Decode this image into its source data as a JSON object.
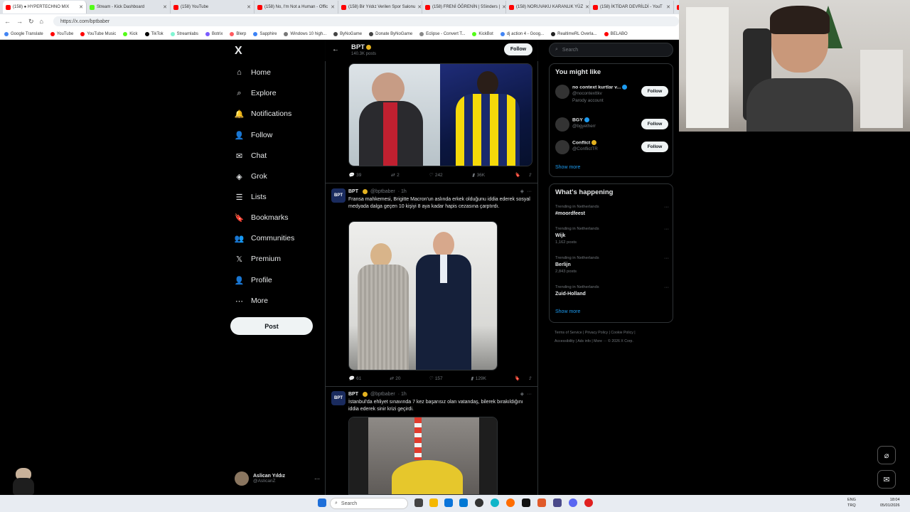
{
  "browser": {
    "tabs": [
      {
        "label": "(158) ● HYPERTECHNO MIX",
        "color": "#ff0000",
        "active": true
      },
      {
        "label": "Stream - Kick Dashboard",
        "color": "#53fc18"
      },
      {
        "label": "(158) YouTube",
        "color": "#ff0000"
      },
      {
        "label": "(158) No, I'm Not a Human - Offic",
        "color": "#ff0000"
      },
      {
        "label": "(158) Bir Yıldız Verilen Spor Salonu",
        "color": "#ff0000"
      },
      {
        "label": "(158) FRENİ ÖĞRENİN | 5Sinders |",
        "color": "#ff0000"
      },
      {
        "label": "(158) NORUVAKU KARANLIK YÜZ",
        "color": "#ff0000"
      },
      {
        "label": "(158) İKTİDAR DEVRİLDİ - YouT",
        "color": "#ff0000"
      },
      {
        "label": "BELABO",
        "color": "#ff0000"
      }
    ],
    "url": "https://x.com/bptbaber",
    "bookmarks": [
      {
        "label": "Google Translate",
        "color": "#4285f4"
      },
      {
        "label": "YouTube",
        "color": "#ff0000"
      },
      {
        "label": "YouTube Music",
        "color": "#ff0000"
      },
      {
        "label": "Kick",
        "color": "#53fc18"
      },
      {
        "label": "TikTok",
        "color": "#000000"
      },
      {
        "label": "Streamlabs",
        "color": "#80f5d2"
      },
      {
        "label": "Botrix",
        "color": "#7b5cff"
      },
      {
        "label": "Blerp",
        "color": "#ff5a5f"
      },
      {
        "label": "Sapphire",
        "color": "#3b82f6"
      },
      {
        "label": "Windows 10 high...",
        "color": "#777777"
      },
      {
        "label": "ByNoGame",
        "color": "#444444"
      },
      {
        "label": "Donate ByNoGame",
        "color": "#444444"
      },
      {
        "label": "Eclipse - Convert T...",
        "color": "#888888"
      },
      {
        "label": "KickBot",
        "color": "#53fc18"
      },
      {
        "label": "dj action 4 - Goog...",
        "color": "#4285f4"
      },
      {
        "label": "RealtimeRL Overla...",
        "color": "#222222"
      },
      {
        "label": "BELABO",
        "color": "#ff0000"
      }
    ]
  },
  "nav": {
    "logo": "X",
    "items": [
      {
        "name": "home",
        "label": "Home",
        "icon": "⌂"
      },
      {
        "name": "explore",
        "label": "Explore",
        "icon": "⌕"
      },
      {
        "name": "notifications",
        "label": "Notifications",
        "icon": "🔔"
      },
      {
        "name": "follow",
        "label": "Follow",
        "icon": "👤"
      },
      {
        "name": "chat",
        "label": "Chat",
        "icon": "✉"
      },
      {
        "name": "grok",
        "label": "Grok",
        "icon": "◈"
      },
      {
        "name": "lists",
        "label": "Lists",
        "icon": "☰"
      },
      {
        "name": "bookmarks",
        "label": "Bookmarks",
        "icon": "🔖"
      },
      {
        "name": "communities",
        "label": "Communities",
        "icon": "👥"
      },
      {
        "name": "premium",
        "label": "Premium",
        "icon": "𝕏"
      },
      {
        "name": "profile",
        "label": "Profile",
        "icon": "👤"
      },
      {
        "name": "more",
        "label": "More",
        "icon": "⋯"
      }
    ],
    "post_label": "Post",
    "account": {
      "name": "Aslican Yıldız",
      "handle": "@AslicanZ"
    }
  },
  "profile_header": {
    "back_icon": "←",
    "title": "BPT",
    "posts_count": "140.3K posts",
    "follow_label": "Follow"
  },
  "tweets": [
    {
      "actions": {
        "replies": "39",
        "reposts": "2",
        "likes": "242",
        "views": "36K"
      }
    },
    {
      "avatar": "BPT",
      "name": "BPT",
      "handle": "@bptbaber",
      "time": "· 1h",
      "text": "Fransa mahkemesi, Brigitte Macron'un aslında erkek olduğunu iddia ederek sosyal medyada dalga geçen 10 kişiyi 8 aya kadar hapis cezasına çarptırdı.",
      "actions": {
        "replies": "61",
        "reposts": "20",
        "likes": "157",
        "views": "129K"
      }
    },
    {
      "avatar": "BPT",
      "name": "BPT",
      "handle": "@bptbaber",
      "time": "· 1h",
      "text": "İstanbul'da ehliyet sınavında 7 kez başarısız olan vatandaş, bilerek bırakıldığını iddia ederek sinir krizi geçirdi."
    }
  ],
  "right": {
    "search_placeholder": "Search",
    "might_like_title": "You might like",
    "who_to_follow": [
      {
        "name": "no context kurtlar v...",
        "handle": "@nocontexttkv",
        "extra": "Parody account",
        "verified": "blue"
      },
      {
        "name": "BGY",
        "handle": "@bgyetherr",
        "extra": "",
        "verified": "blue"
      },
      {
        "name": "Conflict",
        "handle": "@ConflictTR",
        "extra": "",
        "verified": "gold"
      }
    ],
    "follow_label": "Follow",
    "show_more": "Show more",
    "happening_title": "What's happening",
    "trends": [
      {
        "context": "Trending in Netherlands",
        "topic": "#moordfeest",
        "posts": ""
      },
      {
        "context": "Trending in Netherlands",
        "topic": "Wijk",
        "posts": "1,162 posts"
      },
      {
        "context": "Trending in Netherlands",
        "topic": "Berlijn",
        "posts": "2,843 posts"
      },
      {
        "context": "Trending in Netherlands",
        "topic": "Zuid-Holland",
        "posts": ""
      }
    ],
    "footer_line1": "Terms of Service  |  Privacy Policy  |  Cookie Policy  |",
    "footer_line2": "Accessibility  |  Ads info  |  More ···  © 2026 X Corp."
  },
  "taskbar": {
    "search_placeholder": "Search",
    "lang": "ENG\nTRQ",
    "time": "18:04",
    "date": "05/01/2026"
  }
}
